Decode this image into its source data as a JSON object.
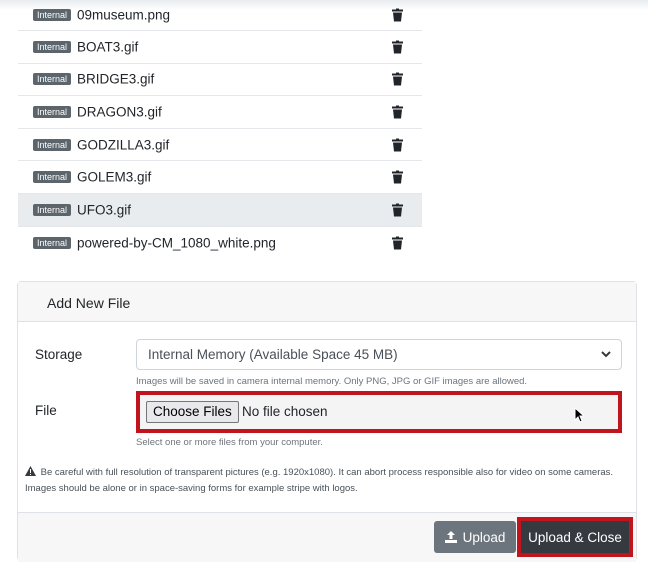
{
  "files": [
    {
      "badge": "Internal",
      "name": "09museum.png"
    },
    {
      "badge": "Internal",
      "name": "BOAT3.gif"
    },
    {
      "badge": "Internal",
      "name": "BRIDGE3.gif"
    },
    {
      "badge": "Internal",
      "name": "DRAGON3.gif"
    },
    {
      "badge": "Internal",
      "name": "GODZILLA3.gif"
    },
    {
      "badge": "Internal",
      "name": "GOLEM3.gif"
    },
    {
      "badge": "Internal",
      "name": "UFO3.gif"
    },
    {
      "badge": "Internal",
      "name": "powered-by-CM_1080_white.png"
    }
  ],
  "add_file": {
    "title": "Add New File",
    "storage_label": "Storage",
    "storage_value": "Internal Memory (Available Space 45 MB)",
    "storage_help": "Images will be saved in camera internal memory. Only PNG, JPG or GIF images are allowed.",
    "file_label": "File",
    "choose_button": "Choose Files",
    "no_file_text": "No file chosen",
    "file_help": "Select one or more files from your computer.",
    "warning": "Be careful with full resolution of transparent pictures (e.g. 1920x1080). It can abort process responsible also for video on some cameras. Images should be alone or in space-saving forms for example stripe with logos."
  },
  "footer": {
    "upload_label": "Upload",
    "upload_close_label": "Upload & Close"
  },
  "colors": {
    "highlight_border": "#c0141e",
    "badge_bg": "#5c646c",
    "upload_bg": "#6c757d",
    "upload_close_bg": "#343a40"
  }
}
